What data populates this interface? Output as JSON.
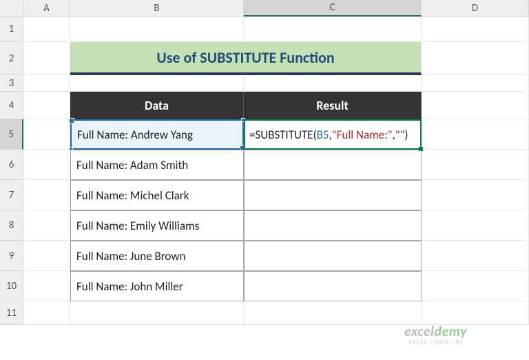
{
  "columns": [
    "A",
    "B",
    "C",
    "D"
  ],
  "rows": [
    "1",
    "2",
    "3",
    "4",
    "5",
    "6",
    "7",
    "8",
    "9",
    "10",
    "11"
  ],
  "title": "Use of SUBSTITUTE Function",
  "headers": {
    "data": "Data",
    "result": "Result"
  },
  "data": [
    "Full Name: Andrew Yang",
    "Full Name: Adam Smith",
    "Full Name: Michel Clark",
    "Full Name: Emily Williams",
    "Full Name: June Brown",
    "Full Name: John Miller"
  ],
  "formula": {
    "prefix": "=SUBSTITUTE(",
    "ref": "B5",
    "mid": ",",
    "str1": "\"Full Name:\"",
    "mid2": ",",
    "str2": "\"\"",
    "suffix": ")"
  },
  "watermark": {
    "brand_a": "excel",
    "brand_b": "demy",
    "tag": "EXCEL · DATA · BI"
  },
  "selected_col": "C",
  "selected_row": "5"
}
